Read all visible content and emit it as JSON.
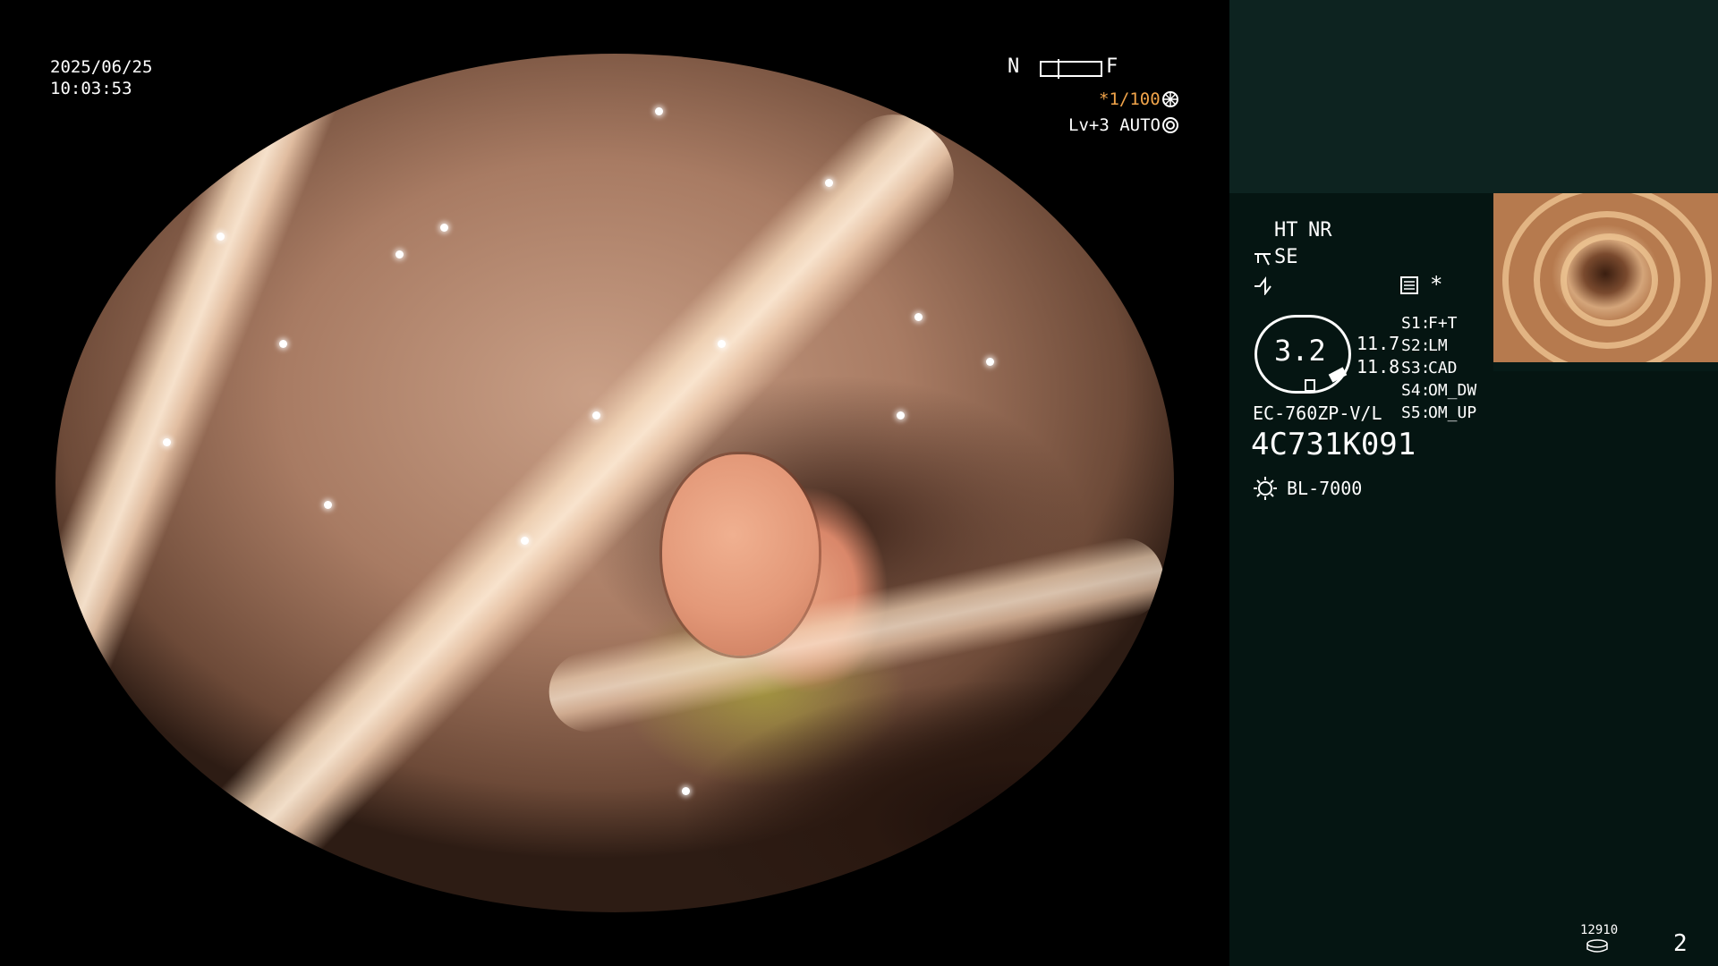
{
  "overlay": {
    "date": "2025/06/25",
    "time": "10:03:53",
    "nf_left": "N",
    "nf_right": "F",
    "shutter": "*1/100",
    "level": "Lv+3 AUTO"
  },
  "panel": {
    "ht": "HT",
    "nr": "NR",
    "se": "SE",
    "asterisk": "*",
    "gauge_value": "3.2",
    "reading_1": "11.7",
    "reading_2": "11.8",
    "scope_model": "EC-760ZP-V/L",
    "serial": "4C731K091",
    "light_source": "BL-7000",
    "switches": [
      {
        "key": "S1:",
        "value": "F+T"
      },
      {
        "key": "S2:",
        "value": "LM"
      },
      {
        "key": "S3:",
        "value": "CAD"
      },
      {
        "key": "S4:",
        "value": "OM_DW"
      },
      {
        "key": "S5:",
        "value": "OM_UP"
      }
    ],
    "storage_count": "12910",
    "page_number": "2"
  },
  "icons": [
    "capture-wheel-icon",
    "auto-iris-icon",
    "scissors-icon",
    "wave-icon",
    "monitor-icon",
    "lamp-icon",
    "disk-icon"
  ],
  "colors": {
    "accent_orange": "#f1a44a",
    "panel_bg": "#051512",
    "header_bg": "#0d2320"
  }
}
